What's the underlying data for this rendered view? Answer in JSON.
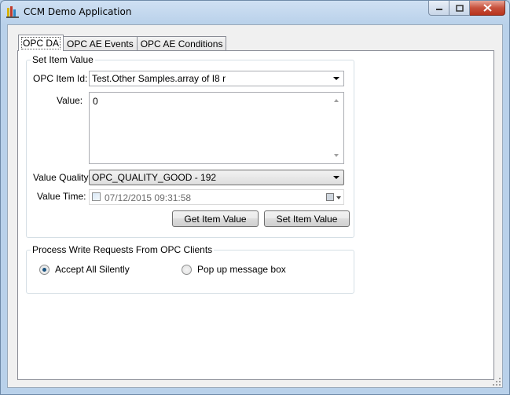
{
  "window": {
    "title": "CCM Demo Application"
  },
  "tabs": [
    {
      "label": "OPC DA"
    },
    {
      "label": "OPC AE Events"
    },
    {
      "label": "OPC AE Conditions"
    }
  ],
  "set_item_value": {
    "legend": "Set Item Value",
    "item_id_label": "OPC Item Id:",
    "item_id_value": "Test.Other Samples.array of I8 r",
    "value_label": "Value:",
    "value_text": "0",
    "quality_label": "Value Quality:",
    "quality_value": "OPC_QUALITY_GOOD - 192",
    "time_label": "Value Time:",
    "time_value": "07/12/2015 09:31:58",
    "get_button": "Get Item Value",
    "set_button": "Set Item Value"
  },
  "write_requests": {
    "legend": "Process Write Requests From OPC Clients",
    "option_accept": "Accept All Silently",
    "option_popup": "Pop up message box",
    "selected": "accept"
  },
  "icons": [
    "app-icon",
    "minimize-icon",
    "maximize-icon",
    "close-icon",
    "calendar-icon",
    "chevron-down-icon",
    "resize-grip-icon"
  ]
}
